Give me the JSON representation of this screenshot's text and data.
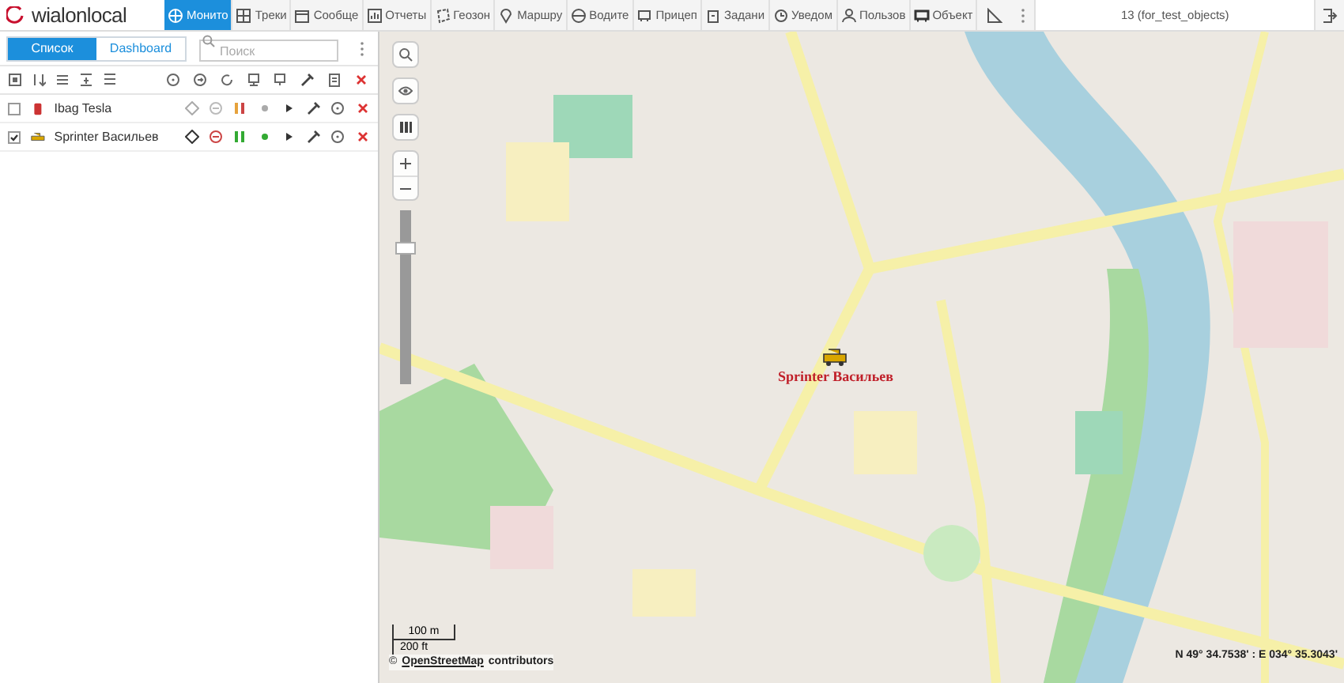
{
  "logo": {
    "text": "wialonlocal"
  },
  "nav_tabs": [
    {
      "label": "Монито",
      "selected": true
    },
    {
      "label": "Треки",
      "selected": false
    },
    {
      "label": "Сообще",
      "selected": false
    },
    {
      "label": "Отчеты",
      "selected": false
    },
    {
      "label": "Геозон",
      "selected": false
    },
    {
      "label": "Маршру",
      "selected": false
    },
    {
      "label": "Водите",
      "selected": false
    },
    {
      "label": "Прицеп",
      "selected": false
    },
    {
      "label": "Задани",
      "selected": false
    },
    {
      "label": "Уведом",
      "selected": false
    },
    {
      "label": "Пользов",
      "selected": false
    },
    {
      "label": "Объект",
      "selected": false
    }
  ],
  "user": {
    "label": "13 (for_test_objects)"
  },
  "panel_tabs": [
    {
      "label": "Список",
      "selected": true
    },
    {
      "label": "Dashboard",
      "selected": false
    }
  ],
  "search": {
    "placeholder": "Поиск"
  },
  "units": [
    {
      "name": "Ibag Tesla",
      "checked": false,
      "active": false
    },
    {
      "name": "Sprinter Васильев",
      "checked": true,
      "active": true
    }
  ],
  "map": {
    "marker_label": "Sprinter Васильев",
    "scale_metric": "100 m",
    "scale_imperial": "200 ft",
    "attribution_prefix": "©",
    "attribution_link": "OpenStreetMap",
    "attribution_suffix": "contributors",
    "coordinates": "N 49° 34.7538' : E 034° 35.3043'",
    "zoom": {
      "level": 0.8
    }
  }
}
